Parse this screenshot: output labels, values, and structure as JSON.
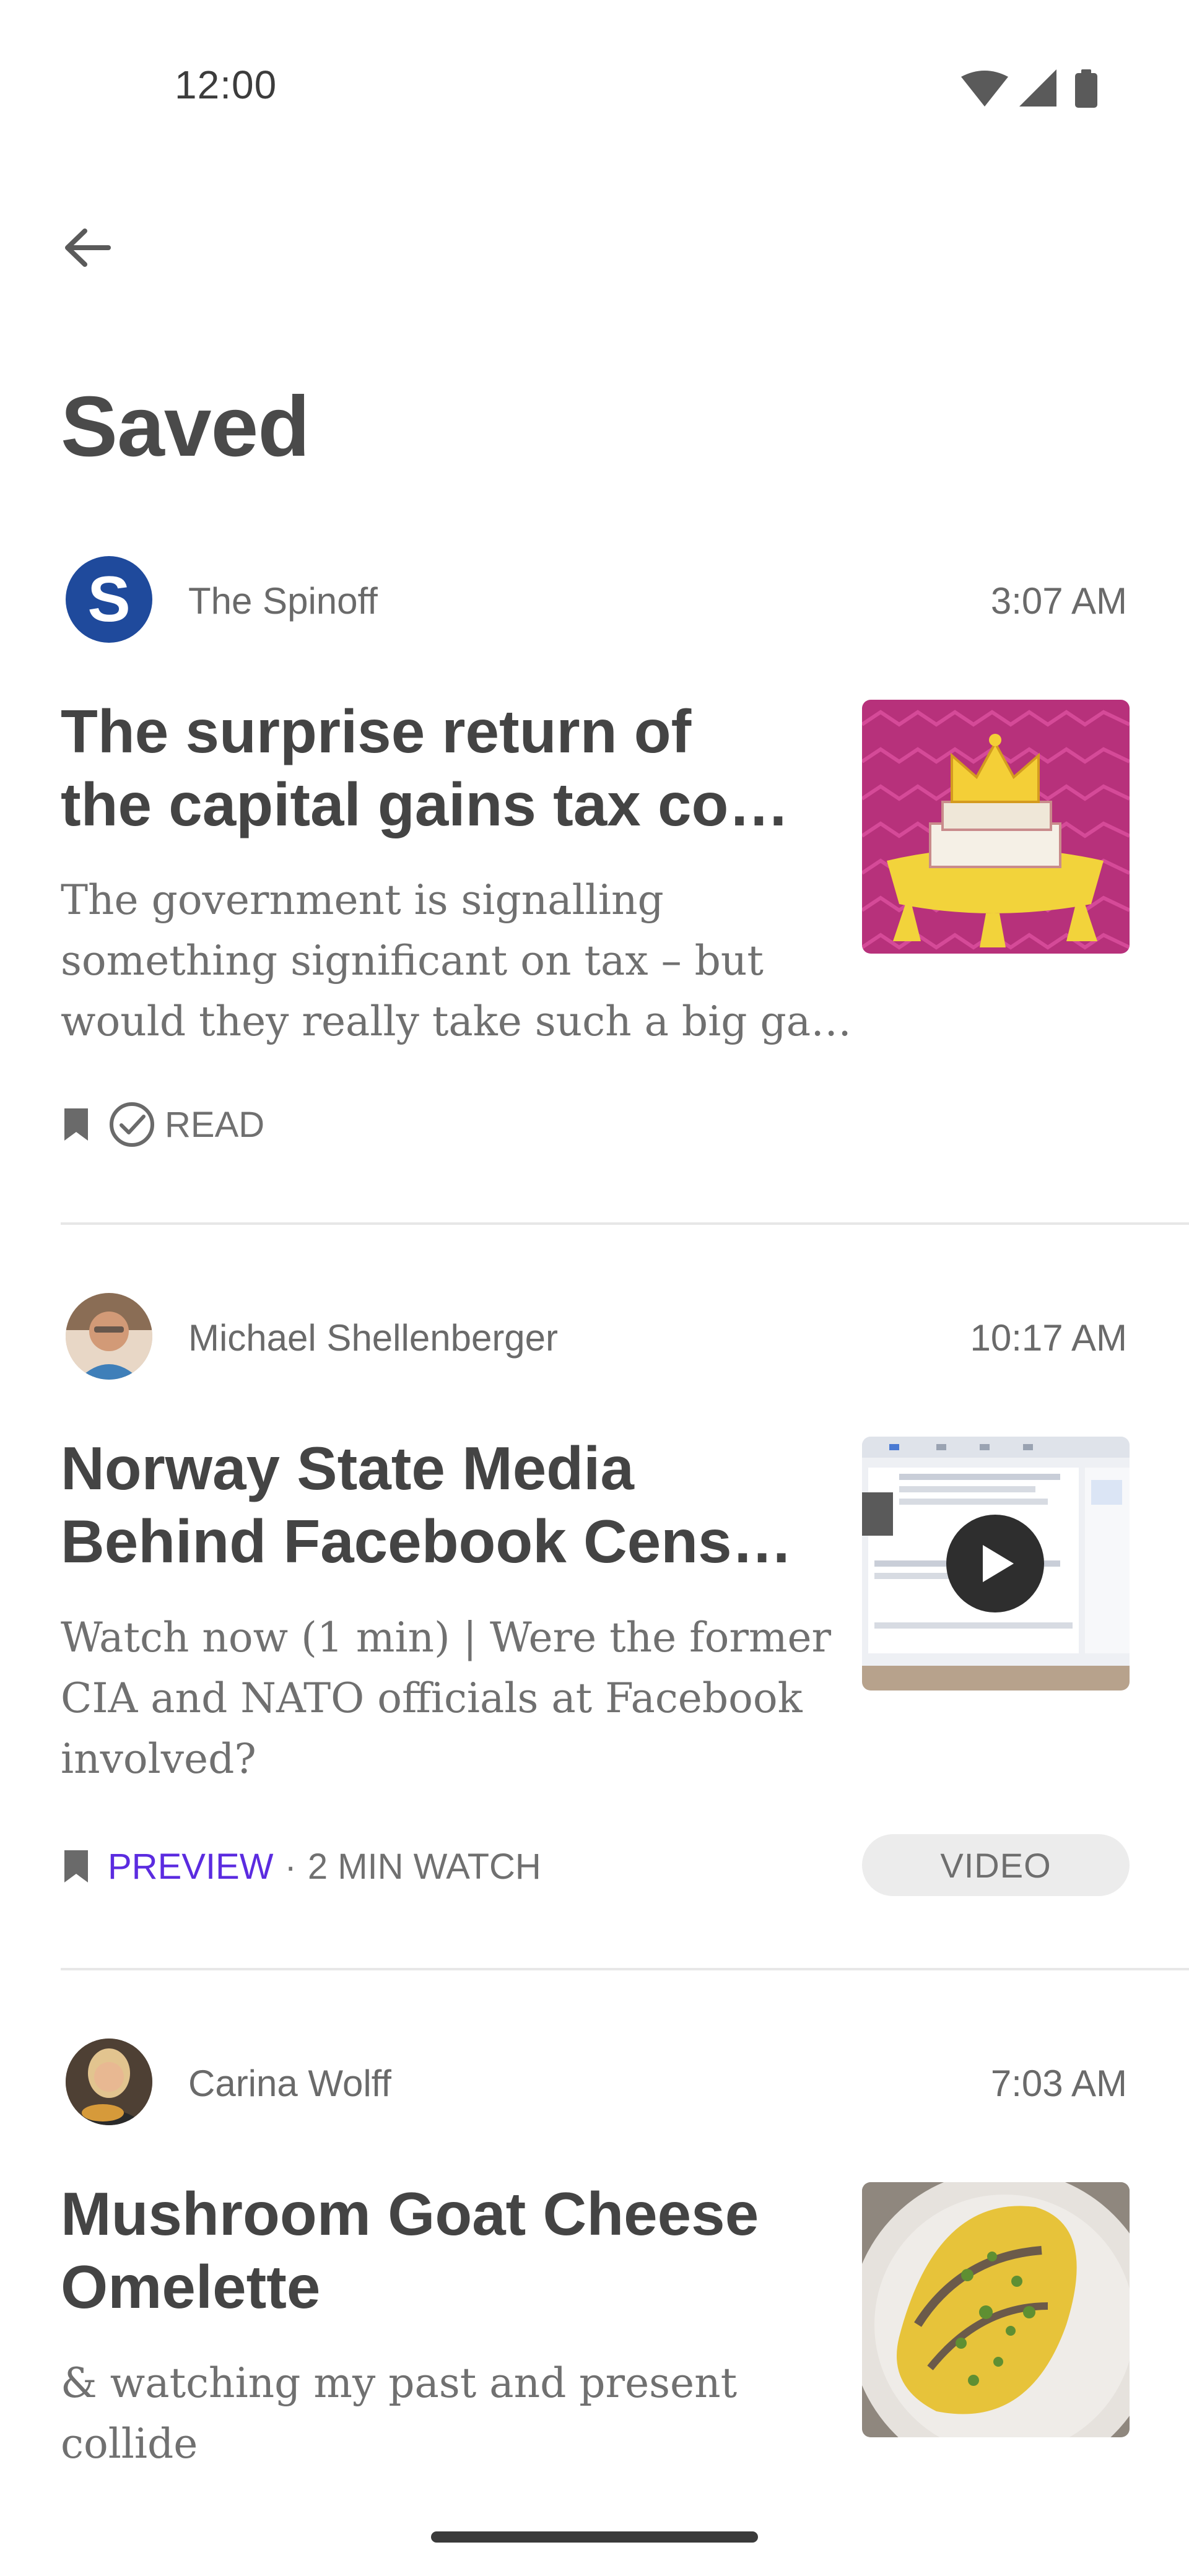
{
  "status_bar": {
    "time": "12:00",
    "icons": [
      "wifi-icon",
      "cellular-signal-icon",
      "battery-icon"
    ]
  },
  "app_bar": {
    "back_icon": "arrow-left-icon",
    "title": "Saved"
  },
  "articles": [
    {
      "author": "The Spinoff",
      "avatar_letter": "S",
      "avatar_color": "#1f4a9c",
      "time": "3:07 AM",
      "title_lines": [
        "The surprise return of",
        "the capital gains tax co…"
      ],
      "subtitle_lines": [
        "The government is signalling",
        "something significant on tax – but",
        "would they really take such a big ga…"
      ],
      "status": "READ",
      "thumbnail": "crown-on-cash-cushion-illustration",
      "thumb_bg": "#b7317b"
    },
    {
      "author": "Michael Shellenberger",
      "time": "10:17 AM",
      "title_lines": [
        "Norway State Media",
        "Behind Facebook Cens…"
      ],
      "subtitle_lines": [
        "Watch now (1 min) | Were the former",
        "CIA and NATO officials at Facebook",
        "involved?"
      ],
      "preview_label": "PREVIEW",
      "meta_separator": "·",
      "watch_time": "2 MIN WATCH",
      "badge": "VIDEO",
      "thumbnail": "facebook-screenshot-with-play-button",
      "play_icon": "play-icon"
    },
    {
      "author": "Carina Wolff",
      "time": "7:03 AM",
      "title_lines": [
        "Mushroom Goat Cheese",
        "Omelette"
      ],
      "subtitle_lines": [
        "& watching my past and present",
        "collide"
      ],
      "thumbnail": "omelette-on-plate-photo"
    }
  ],
  "colors": {
    "accent_preview": "#5b2be0",
    "divider": "#e7e7e7",
    "text_primary": "#444444",
    "text_secondary": "#707070"
  }
}
